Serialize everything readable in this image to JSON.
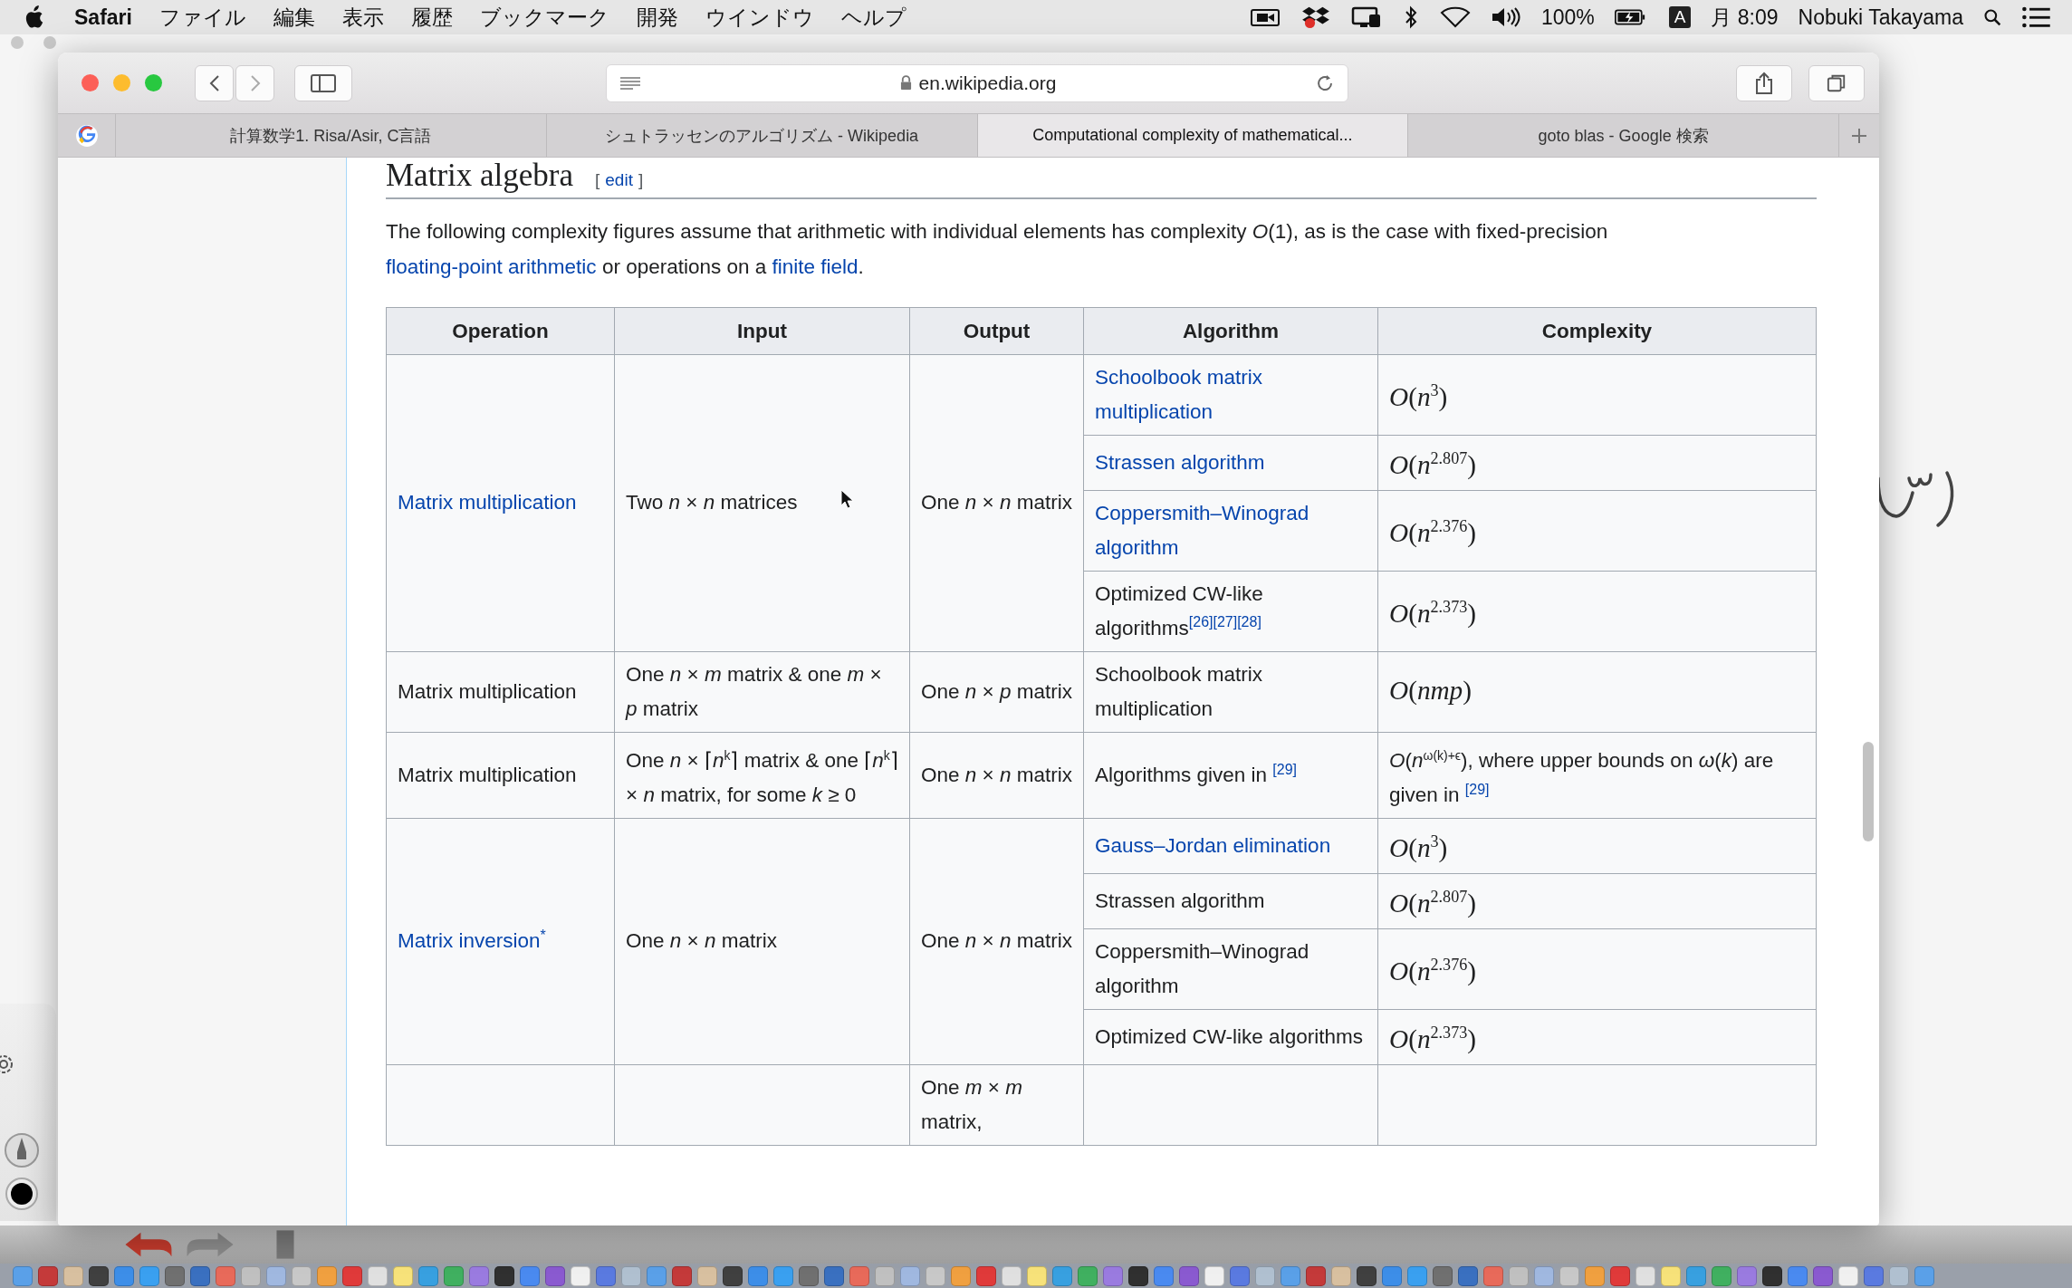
{
  "menu_bar": {
    "app": "Safari",
    "menus": [
      "ファイル",
      "編集",
      "表示",
      "履歴",
      "ブックマーク",
      "開発",
      "ウインドウ",
      "ヘルプ"
    ],
    "battery": "100%",
    "input_source": "A",
    "clock": "月 8:09",
    "user": "Nobuki Takayama"
  },
  "browser": {
    "address": "en.wikipedia.org",
    "tabs": [
      {
        "title": "計算数学1. Risa/Asir, C言語",
        "selected": false
      },
      {
        "title": "シュトラッセンのアルゴリズム - Wikipedia",
        "selected": false
      },
      {
        "title": "Computational complexity of mathematical...",
        "selected": true
      },
      {
        "title": "goto blas - Google 検索",
        "selected": false
      }
    ]
  },
  "article": {
    "heading": "Matrix algebra",
    "edit_open": "[",
    "edit_link": "edit",
    "edit_close": "]",
    "intro": [
      {
        "text": "The following complexity figures assume that arithmetic with individual elements has complexity *O*(1), as is the case with fixed-precision ",
        "link": false
      },
      {
        "text": "floating-point arithmetic",
        "link": true
      },
      {
        "text": " or operations on a ",
        "link": false
      },
      {
        "text": "finite field",
        "link": true
      },
      {
        "text": ".",
        "link": false
      }
    ]
  },
  "table": {
    "columns": [
      "Operation",
      "Input",
      "Output",
      "Algorithm",
      "Complexity"
    ],
    "groups": [
      {
        "operation": {
          "text": "Matrix multiplication",
          "link": true
        },
        "input": {
          "text": "Two *n* × *n* matrices"
        },
        "output": {
          "text": "One *n* × *n* matrix"
        },
        "algorithms": [
          {
            "name": {
              "text": "Schoolbook matrix multiplication",
              "link": true
            },
            "complexity": {
              "text": "*O*(*n*$^{3}$)",
              "kind": "math"
            }
          },
          {
            "name": {
              "text": "Strassen algorithm",
              "link": true
            },
            "complexity": {
              "text": "*O*(*n*$^{2.807}$)",
              "kind": "math"
            }
          },
          {
            "name": {
              "text": "Coppersmith–Winograd algorithm",
              "link": true
            },
            "complexity": {
              "text": "*O*(*n*$^{2.376}$)",
              "kind": "math"
            }
          },
          {
            "name": {
              "text": "Optimized CW-like algorithms",
              "link": false,
              "refs": "[26][27][28]"
            },
            "complexity": {
              "text": "*O*(*n*$^{2.373}$)",
              "kind": "math"
            }
          }
        ]
      },
      {
        "operation": {
          "text": "Matrix multiplication",
          "link": false
        },
        "input": {
          "text": "One *n* × *m* matrix & one *m* × *p* matrix"
        },
        "output": {
          "text": "One *n* × *p* matrix"
        },
        "algorithms": [
          {
            "name": {
              "text": "Schoolbook matrix multiplication",
              "link": false
            },
            "complexity": {
              "text": "*O*(*nmp*)",
              "kind": "math"
            }
          }
        ]
      },
      {
        "operation": {
          "text": "Matrix multiplication",
          "link": false
        },
        "input": {
          "text": "One *n* × ⌈*n*$^{k}$⌉ matrix & one ⌈*n*$^{k}$⌉ × *n* matrix, for some *k* ≥ 0"
        },
        "output": {
          "text": "One *n* × *n* matrix"
        },
        "algorithms": [
          {
            "name": {
              "text": "Algorithms given in ",
              "link": false,
              "refs": "[29]"
            },
            "complexity": {
              "text": "*O*(*n*$^{ω(k)+ϵ}$), where upper bounds on *ω*(*k*) are given in ",
              "kind": "text",
              "refs": "[29]"
            }
          }
        ]
      },
      {
        "operation": {
          "text": "Matrix inversion",
          "link": true,
          "refs": "*"
        },
        "input": {
          "text": "One *n* × *n* matrix"
        },
        "output": {
          "text": "One *n* × *n* matrix"
        },
        "algorithms": [
          {
            "name": {
              "text": "Gauss–Jordan elimination",
              "link": true
            },
            "complexity": {
              "text": "*O*(*n*$^{3}$)",
              "kind": "math"
            }
          },
          {
            "name": {
              "text": "Strassen algorithm",
              "link": false
            },
            "complexity": {
              "text": "*O*(*n*$^{2.807}$)",
              "kind": "math"
            }
          },
          {
            "name": {
              "text": "Coppersmith–Winograd algorithm",
              "link": false
            },
            "complexity": {
              "text": "*O*(*n*$^{2.376}$)",
              "kind": "math"
            }
          },
          {
            "name": {
              "text": "Optimized CW-like algorithms",
              "link": false
            },
            "complexity": {
              "text": "*O*(*n*$^{2.373}$)",
              "kind": "math"
            }
          }
        ]
      },
      {
        "output": {
          "text": "One *m* × *m* matrix,"
        }
      }
    ]
  }
}
